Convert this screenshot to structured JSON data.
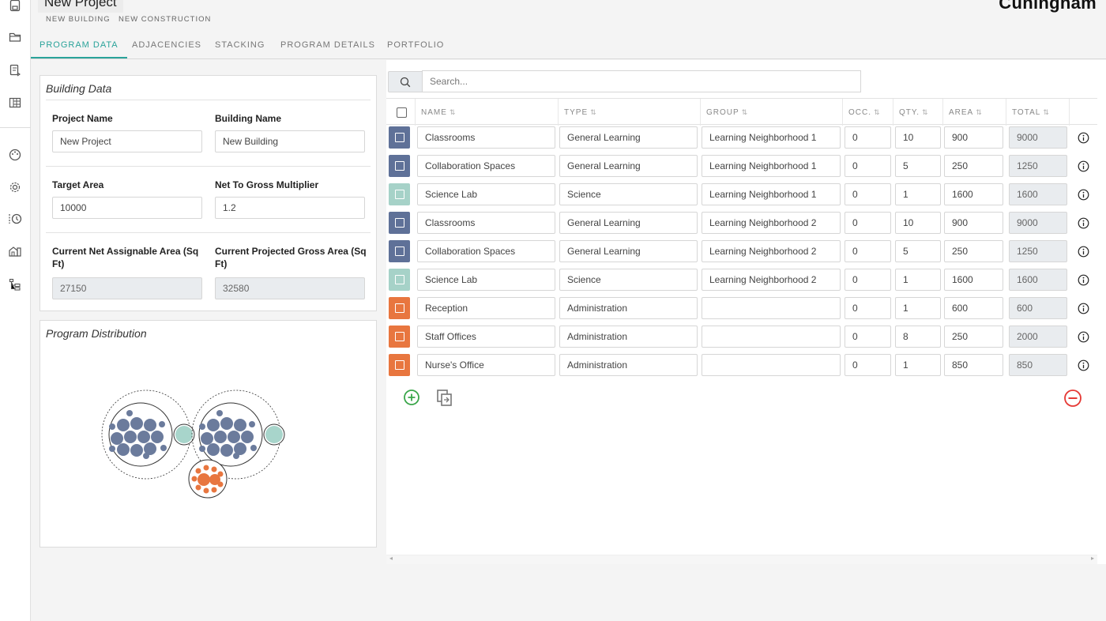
{
  "header": {
    "project_title": "New Project",
    "subtitle_building": "NEW BUILDING",
    "subtitle_construction": "NEW CONSTRUCTION",
    "brand": "Cuningham"
  },
  "rail": {
    "icons": [
      "save-icon",
      "folder-icon",
      "export-icon",
      "layout-icon",
      "palette-icon",
      "settings-icon",
      "history-icon",
      "building-icon",
      "tree-icon"
    ]
  },
  "tabs": [
    {
      "label": "PROGRAM DATA",
      "active": true
    },
    {
      "label": "ADJACENCIES",
      "active": false
    },
    {
      "label": "STACKING",
      "active": false
    },
    {
      "label": "PROGRAM DETAILS",
      "active": false
    },
    {
      "label": "PORTFOLIO",
      "active": false
    }
  ],
  "building_data": {
    "title": "Building Data",
    "project_name_label": "Project Name",
    "project_name_value": "New Project",
    "building_name_label": "Building Name",
    "building_name_value": "New Building",
    "target_area_label": "Target Area",
    "target_area_value": "10000",
    "net_to_gross_label": "Net To Gross Multiplier",
    "net_to_gross_value": "1.2",
    "net_assignable_label": "Current Net Assignable Area (Sq Ft)",
    "net_assignable_value": "27150",
    "projected_gross_label": "Current Projected Gross Area (Sq Ft)",
    "projected_gross_value": "32580"
  },
  "program_distribution": {
    "title": "Program Distribution",
    "colors": {
      "learning": "#6b7b9c",
      "science": "#a8d5cb",
      "admin": "#e8763f"
    }
  },
  "search": {
    "placeholder": "Search..."
  },
  "table": {
    "columns": [
      {
        "label": "NAME"
      },
      {
        "label": "TYPE"
      },
      {
        "label": "GROUP"
      },
      {
        "label": "OCC."
      },
      {
        "label": "QTY."
      },
      {
        "label": "AREA"
      },
      {
        "label": "TOTAL"
      }
    ],
    "rows": [
      {
        "color": "#5f7198",
        "name": "Classrooms",
        "type": "General Learning",
        "group": "Learning Neighborhood 1",
        "occ": "0",
        "qty": "10",
        "area": "900",
        "total": "9000"
      },
      {
        "color": "#5f7198",
        "name": "Collaboration Spaces",
        "type": "General Learning",
        "group": "Learning Neighborhood 1",
        "occ": "0",
        "qty": "5",
        "area": "250",
        "total": "1250"
      },
      {
        "color": "#a6d2c8",
        "name": "Science Lab",
        "type": "Science",
        "group": "Learning Neighborhood 1",
        "occ": "0",
        "qty": "1",
        "area": "1600",
        "total": "1600"
      },
      {
        "color": "#5f7198",
        "name": "Classrooms",
        "type": "General Learning",
        "group": "Learning Neighborhood 2",
        "occ": "0",
        "qty": "10",
        "area": "900",
        "total": "9000"
      },
      {
        "color": "#5f7198",
        "name": "Collaboration Spaces",
        "type": "General Learning",
        "group": "Learning Neighborhood 2",
        "occ": "0",
        "qty": "5",
        "area": "250",
        "total": "1250"
      },
      {
        "color": "#a6d2c8",
        "name": "Science Lab",
        "type": "Science",
        "group": "Learning Neighborhood 2",
        "occ": "0",
        "qty": "1",
        "area": "1600",
        "total": "1600"
      },
      {
        "color": "#e8763f",
        "name": "Reception",
        "type": "Administration",
        "group": "",
        "occ": "0",
        "qty": "1",
        "area": "600",
        "total": "600"
      },
      {
        "color": "#e8763f",
        "name": "Staff Offices",
        "type": "Administration",
        "group": "",
        "occ": "0",
        "qty": "8",
        "area": "250",
        "total": "2000"
      },
      {
        "color": "#e8763f",
        "name": "Nurse's Office",
        "type": "Administration",
        "group": "",
        "occ": "0",
        "qty": "1",
        "area": "850",
        "total": "850"
      }
    ]
  },
  "actions": {
    "add_icon": "plus-circle-icon",
    "duplicate_icon": "copy-icon",
    "remove_icon": "minus-circle-icon",
    "add_color": "#3aa64a",
    "remove_color": "#e53935"
  }
}
